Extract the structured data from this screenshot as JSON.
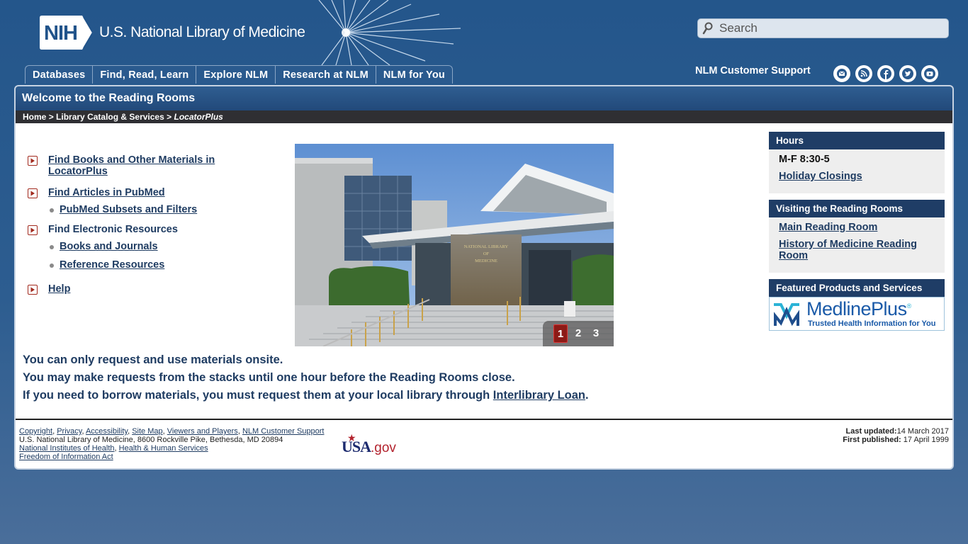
{
  "header": {
    "logo_badge": "NIH",
    "site_name": "U.S. National Library of Medicine",
    "search_placeholder": "Search",
    "tabs": [
      "Databases",
      "Find, Read, Learn",
      "Explore NLM",
      "Research at NLM",
      "NLM for You"
    ],
    "support_link": "NLM Customer Support",
    "social_icons": [
      "email-icon",
      "rss-icon",
      "facebook-icon",
      "twitter-icon",
      "youtube-icon"
    ]
  },
  "page": {
    "title": "Welcome to the Reading Rooms",
    "breadcrumb": {
      "home": "Home",
      "sep": ">",
      "section": "Library Catalog & Services",
      "current": "LocatorPlus"
    }
  },
  "links": {
    "find_books": "Find Books and Other Materials in LocatorPlus",
    "find_articles": "Find Articles in PubMed",
    "pubmed_subsets": "PubMed Subsets and Filters",
    "electronic": "Find Electronic Resources",
    "books_journals": "Books and Journals",
    "reference": "Reference Resources",
    "help": "Help"
  },
  "carousel": {
    "building_sign": "NATIONAL LIBRARY OF MEDICINE",
    "pages": [
      "1",
      "2",
      "3"
    ],
    "active_page": "1"
  },
  "notes": {
    "line1": "You can only request and use materials onsite.",
    "line2": "You may make requests from the stacks until one hour before the Reading Rooms close.",
    "line3_prefix": "If you need to borrow materials, you must request them at your local library through",
    "line3_link": "Interlibrary Loan",
    "line3_suffix": "."
  },
  "sidebar": {
    "hours_title": "Hours",
    "hours_value": "M-F 8:30-5",
    "holiday_link": "Holiday Closings",
    "visiting_title": "Visiting the Reading Rooms",
    "main_room_link": "Main Reading Room",
    "history_link": "History of Medicine Reading Room",
    "featured_title": "Featured Products and Services",
    "medlineplus_name": "MedlinePlus",
    "medlineplus_tagline": "Trusted Health Information for You"
  },
  "footer": {
    "copyright": "Copyright",
    "privacy": "Privacy",
    "accessibility": "Accessibility",
    "sitemap": "Site Map",
    "viewers": "Viewers and Players",
    "support": "NLM Customer Support",
    "address": "U.S. National Library of Medicine, 8600 Rockville Pike, Bethesda, MD 20894",
    "nih": "National Institutes of Health",
    "hhs": "Health & Human Services",
    "foia": "Freedom of Information Act",
    "usa_main": "USA",
    "usa_suffix": ".gov",
    "last_updated_label": "Last updated:",
    "last_updated_value": "14 March 2017",
    "first_published_label": "First published:",
    "first_published_value": "17 April 1999"
  },
  "colors": {
    "page_bg": "#24568b",
    "header_bar": "#22497a",
    "link": "#1f3c62",
    "active_page": "#8c1b17",
    "bullet_red": "#a22a1e"
  }
}
